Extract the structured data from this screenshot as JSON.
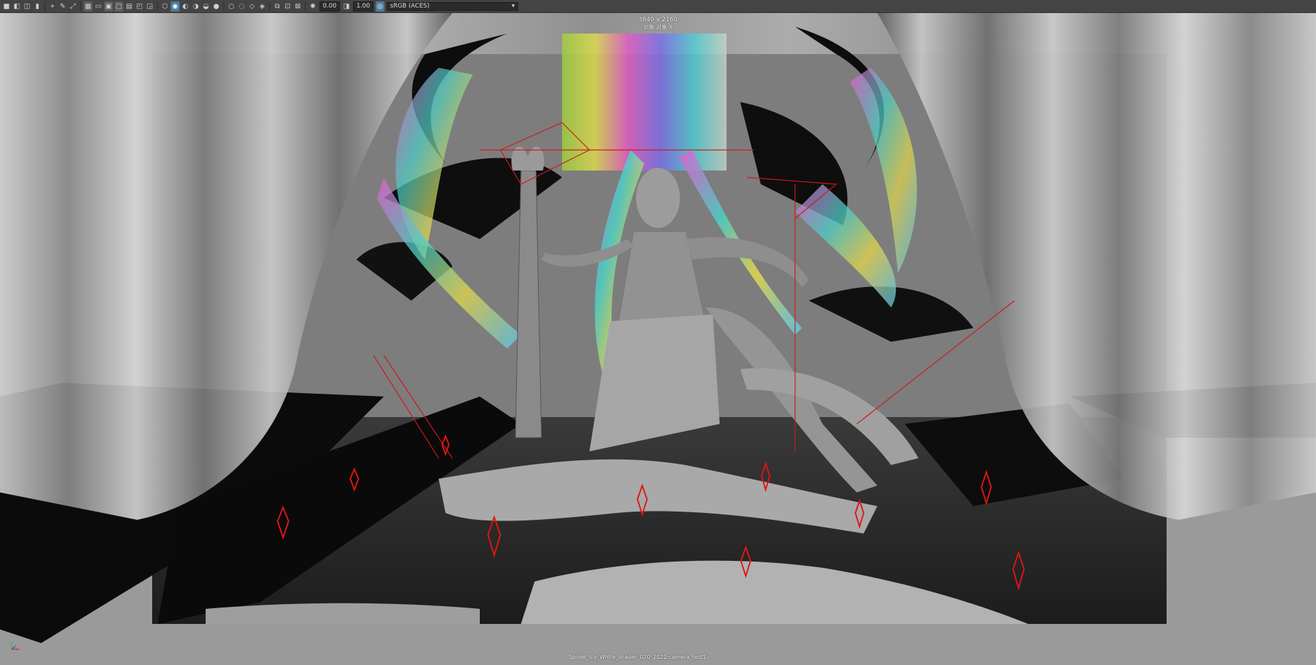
{
  "toolbar": {
    "exposure_value": "0.00",
    "gamma_value": "1.00",
    "color_space": "sRGB (ACES)",
    "icons": [
      "camera-icon",
      "select-camera-icon",
      "camera-attributes-icon",
      "bookmark-icon",
      "image-plane-icon",
      "grease-pencil-icon",
      "two-d-pan-icon",
      "grid-icon",
      "film-gate-icon",
      "resolution-gate-icon",
      "gate-mask-icon",
      "field-chart-icon",
      "safe-action-icon",
      "safe-title-icon",
      "wireframe-icon",
      "smooth-shade-icon",
      "textured-icon",
      "lights-icon",
      "shadows-icon",
      "ambient-occlusion-icon",
      "motion-blur-icon",
      "anti-alias-icon",
      "isolate-icon",
      "xray-icon",
      "xray-joints-icon",
      "backface-icon",
      "exposure-icon",
      "gamma-icon",
      "colorspace-icon"
    ]
  },
  "viewport": {
    "resolution_label": "3840 x 2160",
    "overlay_label": "对象 对象 X",
    "camera_label": "Spider_lily_White_shader_020_2022:camera_test1"
  },
  "colors": {
    "toolbar_bg": "#444444",
    "viewport_bg": "#909090",
    "gate_bg": "#7a7a7a",
    "helper_red": "#d01818",
    "accent_blue": "#4a7a9b"
  }
}
